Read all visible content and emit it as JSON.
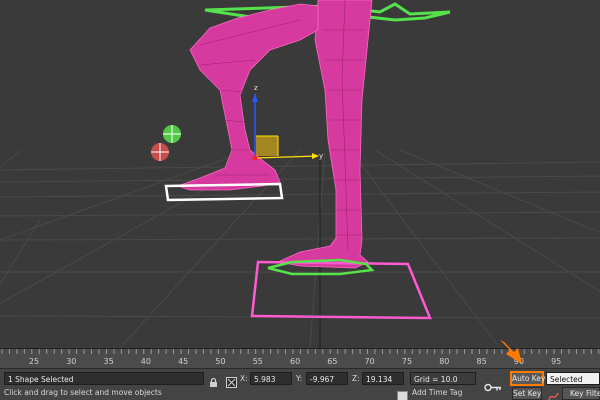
{
  "timeline": {
    "ticks": [
      "25",
      "30",
      "35",
      "40",
      "45",
      "50",
      "55",
      "60",
      "65",
      "70",
      "75",
      "80",
      "85",
      "90",
      "95"
    ]
  },
  "status": {
    "selection": "1 Shape Selected",
    "prompt": "Click and drag to select and move objects",
    "x_label": "X:",
    "x_value": "5.983",
    "y_label": "Y:",
    "y_value": "-9.967",
    "z_label": "Z:",
    "z_value": "19.134",
    "grid": "Grid = 10.0",
    "add_time_tag": "Add Time Tag",
    "auto_key": "Auto Key",
    "set_key": "Set Key",
    "selected_dropdown": "Selected",
    "key_filters": "Key Filte"
  },
  "gizmo": {
    "axis_y": "y",
    "axis_z": "z"
  },
  "colors": {
    "leg": "#d63a9e",
    "wire": "#ff66c4",
    "accent": "#ff7a00",
    "gizmo_x": "#ffe000",
    "gizmo_z": "#2b57ff",
    "helper_green": "#56e24a",
    "helper_red": "#e05050"
  }
}
